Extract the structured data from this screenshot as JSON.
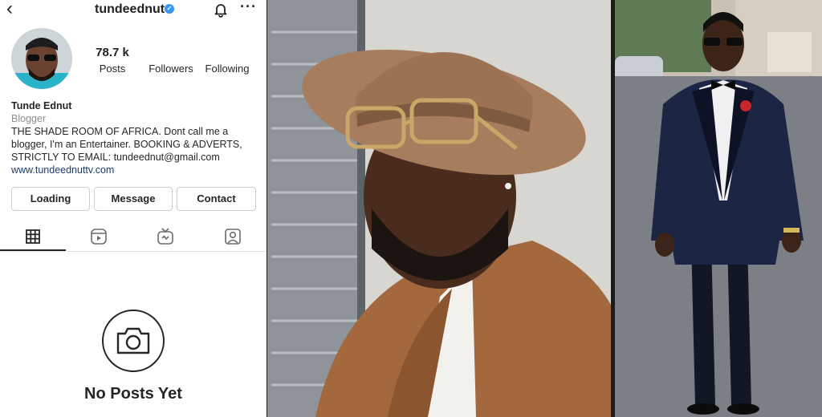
{
  "profile": {
    "username": "tundeednut",
    "verified": true,
    "stats": {
      "posts_value": "78.7 k",
      "posts_label": "Posts",
      "followers_value": "",
      "followers_label": "Followers",
      "following_value": "",
      "following_label": "Following"
    },
    "name": "Tunde Ednut",
    "category": "Blogger",
    "bio": "THE SHADE ROOM OF AFRICA. Dont call me a blogger, I'm an Entertainer. BOOKING & ADVERTS, STRICTLY TO EMAIL: tundeednut@gmail.com",
    "website": "www.tundeednuttv.com",
    "buttons": {
      "loading": "Loading",
      "message": "Message",
      "contact": "Contact"
    },
    "empty_state": "No Posts Yet"
  },
  "icons": {
    "back": "back-arrow-icon",
    "bell": "bell-icon",
    "more": "more-icon",
    "grid_tab": "grid-icon",
    "reels_tab": "reels-icon",
    "igtv_tab": "igtv-icon",
    "tagged_tab": "tagged-icon",
    "camera": "camera-icon"
  },
  "colors": {
    "verified_badge": "#3897f0",
    "link": "#1d3a6b",
    "text": "#262626",
    "secondary_text": "#8e8e8e"
  }
}
